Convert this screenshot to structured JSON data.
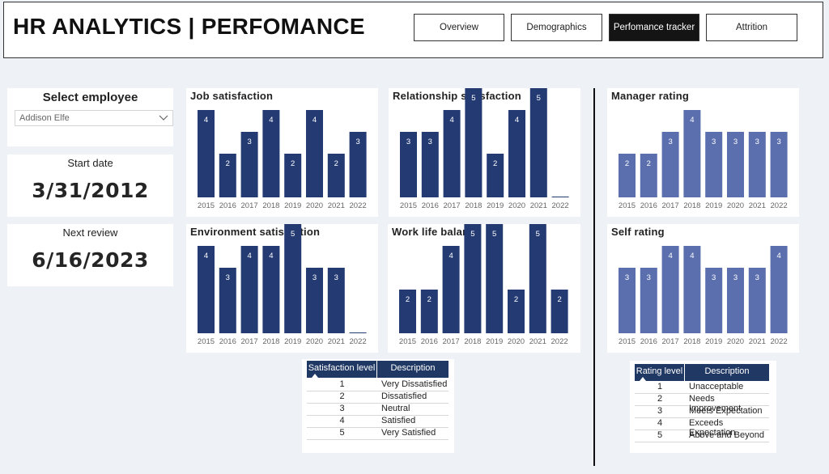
{
  "header": {
    "title": "HR ANALYTICS | PERFOMANCE",
    "nav": [
      {
        "label": "Overview",
        "active": false
      },
      {
        "label": "Demographics",
        "active": false
      },
      {
        "label": "Perfomance tracker",
        "active": true
      },
      {
        "label": "Attrition",
        "active": false
      }
    ]
  },
  "employee": {
    "select_label": "Select employee",
    "selected": "Addison Elfe",
    "start_label": "Start date",
    "start_value": "3/31/2012",
    "review_label": "Next review",
    "review_value": "6/16/2023"
  },
  "colors": {
    "satisfaction_bar": "#243a73",
    "rating_bar": "#5b6fae",
    "legend_header": "#203864"
  },
  "chart_data": [
    {
      "id": "job",
      "type": "bar",
      "title": "Job satisfaction",
      "categories": [
        "2015",
        "2016",
        "2017",
        "2018",
        "2019",
        "2020",
        "2021",
        "2022"
      ],
      "values": [
        4,
        2,
        3,
        4,
        2,
        4,
        2,
        3
      ],
      "ylim": [
        0,
        5
      ]
    },
    {
      "id": "relationship",
      "type": "bar",
      "title": "Relationship satisfaction",
      "categories": [
        "2015",
        "2016",
        "2017",
        "2018",
        "2019",
        "2020",
        "2021",
        "2022"
      ],
      "values": [
        3,
        3,
        4,
        5,
        2,
        4,
        5,
        null
      ],
      "ylim": [
        0,
        5
      ]
    },
    {
      "id": "environment",
      "type": "bar",
      "title": "Environment satisfaction",
      "categories": [
        "2015",
        "2016",
        "2017",
        "2018",
        "2019",
        "2020",
        "2021",
        "2022"
      ],
      "values": [
        4,
        3,
        4,
        4,
        5,
        3,
        3,
        null
      ],
      "ylim": [
        0,
        5
      ]
    },
    {
      "id": "worklife",
      "type": "bar",
      "title": "Work life balance",
      "categories": [
        "2015",
        "2016",
        "2017",
        "2018",
        "2019",
        "2020",
        "2021",
        "2022"
      ],
      "values": [
        2,
        2,
        4,
        5,
        5,
        2,
        5,
        2
      ],
      "ylim": [
        0,
        5
      ]
    },
    {
      "id": "manager",
      "type": "bar",
      "title": "Manager rating",
      "categories": [
        "2015",
        "2016",
        "2017",
        "2018",
        "2019",
        "2020",
        "2021",
        "2022"
      ],
      "values": [
        2,
        2,
        3,
        4,
        3,
        3,
        3,
        3
      ],
      "ylim": [
        0,
        5
      ]
    },
    {
      "id": "self",
      "type": "bar",
      "title": "Self rating",
      "categories": [
        "2015",
        "2016",
        "2017",
        "2018",
        "2019",
        "2020",
        "2021",
        "2022"
      ],
      "values": [
        3,
        3,
        4,
        4,
        3,
        3,
        3,
        4
      ],
      "ylim": [
        0,
        5
      ]
    }
  ],
  "satisfaction_legend": {
    "col1": "Satisfaction level",
    "col2": "Description",
    "rows": [
      {
        "level": "1",
        "desc": "Very Dissatisfied"
      },
      {
        "level": "2",
        "desc": "Dissatisfied"
      },
      {
        "level": "3",
        "desc": "Neutral"
      },
      {
        "level": "4",
        "desc": "Satisfied"
      },
      {
        "level": "5",
        "desc": "Very Satisfied"
      }
    ]
  },
  "rating_legend": {
    "col1": "Rating level",
    "col2": "Description",
    "rows": [
      {
        "level": "1",
        "desc": "Unacceptable"
      },
      {
        "level": "2",
        "desc": "Needs Improvement"
      },
      {
        "level": "3",
        "desc": "Meets Expectation"
      },
      {
        "level": "4",
        "desc": "Exceeds Expectation"
      },
      {
        "level": "5",
        "desc": "Above and Beyond"
      }
    ]
  }
}
